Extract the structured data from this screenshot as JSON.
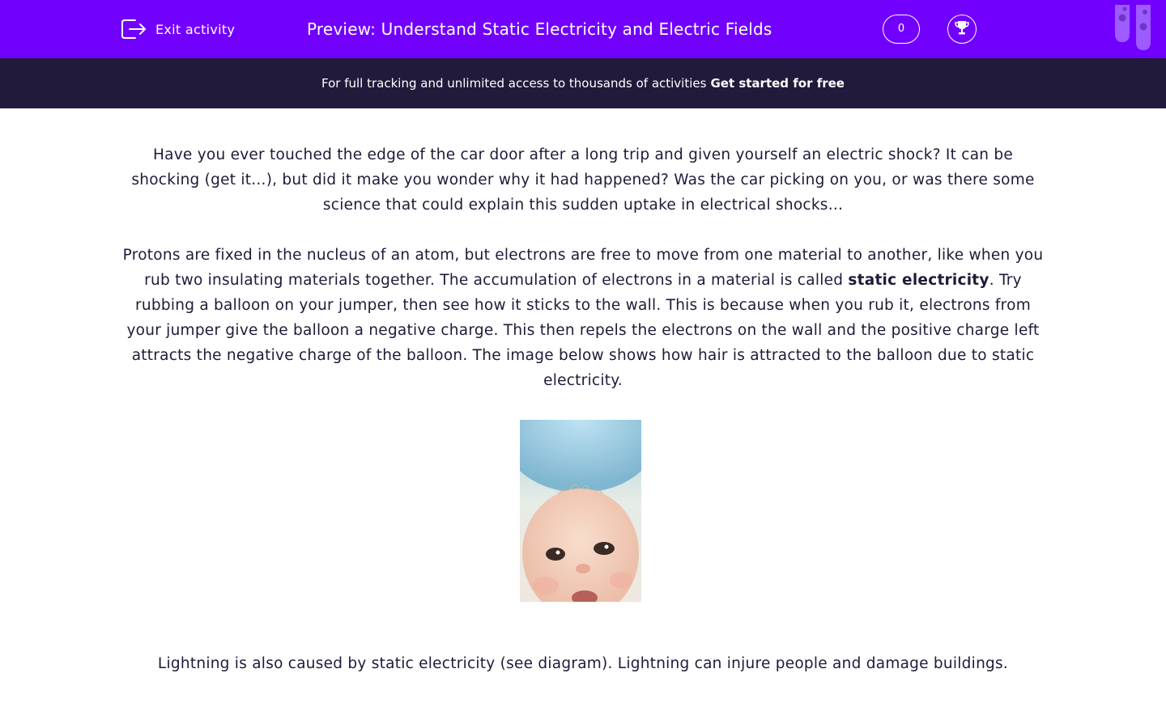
{
  "header": {
    "exit_label": "Exit activity",
    "title": "Preview: Understand Static Electricity and Electric Fields",
    "score": "0",
    "brand_color": "#7200ff"
  },
  "banner": {
    "text": "For full tracking and unlimited access to thousands of activities",
    "cta": "Get started for free"
  },
  "content": {
    "paragraph1": "Have you ever touched the edge of the car door after a long trip and given yourself an electric shock? It can be shocking (get it...), but did it make you wonder why it had happened? Was the car picking on you, or was there some science that could explain this sudden uptake in electrical shocks...",
    "paragraph2_before": "Protons are fixed in the nucleus of an atom, but electrons are free to move from one material to another, like when you rub two insulating materials together. The accumulation of electrons in a material is called ",
    "paragraph2_bold": "static electricity",
    "paragraph2_after": ". Try rubbing a balloon on your jumper, then see how it sticks to the wall. This is because when you rub it, electrons from your jumper give the balloon a negative charge. This then repels the electrons on the wall and the positive charge left attracts the negative charge of the balloon. The image below shows how hair is attracted to the balloon due to static electricity.",
    "paragraph3": "Lightning is also caused by static electricity (see diagram). Lightning can injure people and damage buildings."
  },
  "icons": {
    "exit": "exit-icon",
    "trophy": "trophy-icon",
    "tubes": "test-tubes-icon"
  }
}
